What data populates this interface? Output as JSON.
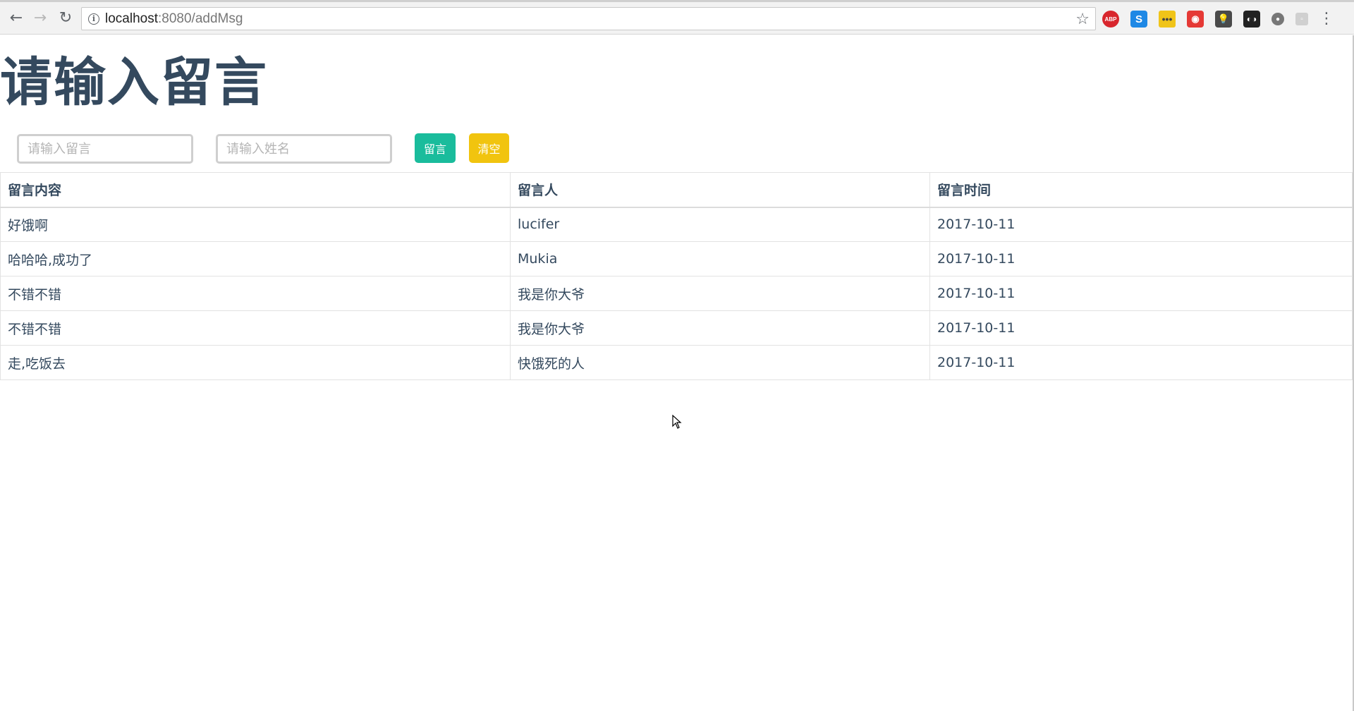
{
  "browser": {
    "url_host": "localhost",
    "url_path": ":8080/addMsg"
  },
  "page": {
    "title": "请输入留言",
    "message_input": {
      "value": "",
      "placeholder": "请输入留言"
    },
    "name_input": {
      "value": "",
      "placeholder": "请输入姓名"
    },
    "submit_label": "留言",
    "clear_label": "清空",
    "table": {
      "headers": [
        "留言内容",
        "留言人",
        "留言时间"
      ],
      "rows": [
        [
          "好饿啊",
          "lucifer",
          "2017-10-11"
        ],
        [
          "哈哈哈,成功了",
          "Mukia",
          "2017-10-11"
        ],
        [
          "不错不错",
          "我是你大爷",
          "2017-10-11"
        ],
        [
          "不错不错",
          "我是你大爷",
          "2017-10-11"
        ],
        [
          "走,吃饭去",
          "快饿死的人",
          "2017-10-11"
        ]
      ]
    }
  },
  "colors": {
    "submit_button": "#1abc9c",
    "clear_button": "#f1c40f",
    "text": "#34495e"
  }
}
